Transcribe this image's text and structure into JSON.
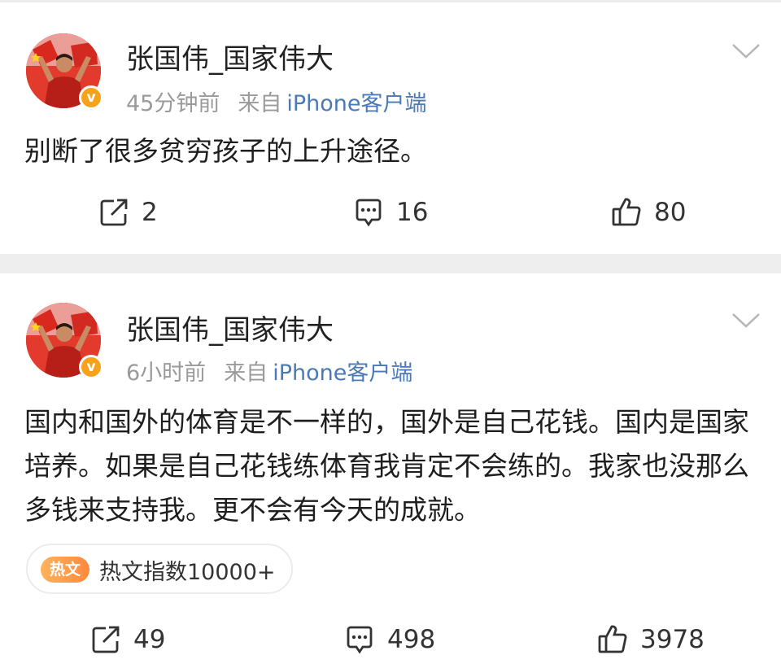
{
  "posts": [
    {
      "author": "张国伟_国家伟大",
      "verified_badge": "v",
      "time": "45分钟前",
      "source_label": "来自",
      "source_device": "iPhone客户端",
      "text": "别断了很多贫穷孩子的上升途径。",
      "reposts": "2",
      "comments": "16",
      "likes": "80"
    },
    {
      "author": "张国伟_国家伟大",
      "verified_badge": "v",
      "time": "6小时前",
      "source_label": "来自",
      "source_device": "iPhone客户端",
      "text": "国内和国外的体育是不一样的，国外是自己花钱。国内是国家培养。如果是自己花钱练体育我肯定不会练的。我家也没那么多钱来支持我。更不会有今天的成就。",
      "hot_badge": "热文",
      "hot_text": "热文指数10000+",
      "reposts": "49",
      "comments": "498",
      "likes": "3978"
    }
  ],
  "icons": {
    "repost": "repost-icon",
    "comment": "comment-icon",
    "like": "thumbs-up-icon",
    "menu": "chevron-down-icon"
  },
  "colors": {
    "link": "#4a7ab5",
    "verified": "#f7a21b",
    "hot": "#ff8a3c",
    "meta": "#9a9a9a"
  }
}
